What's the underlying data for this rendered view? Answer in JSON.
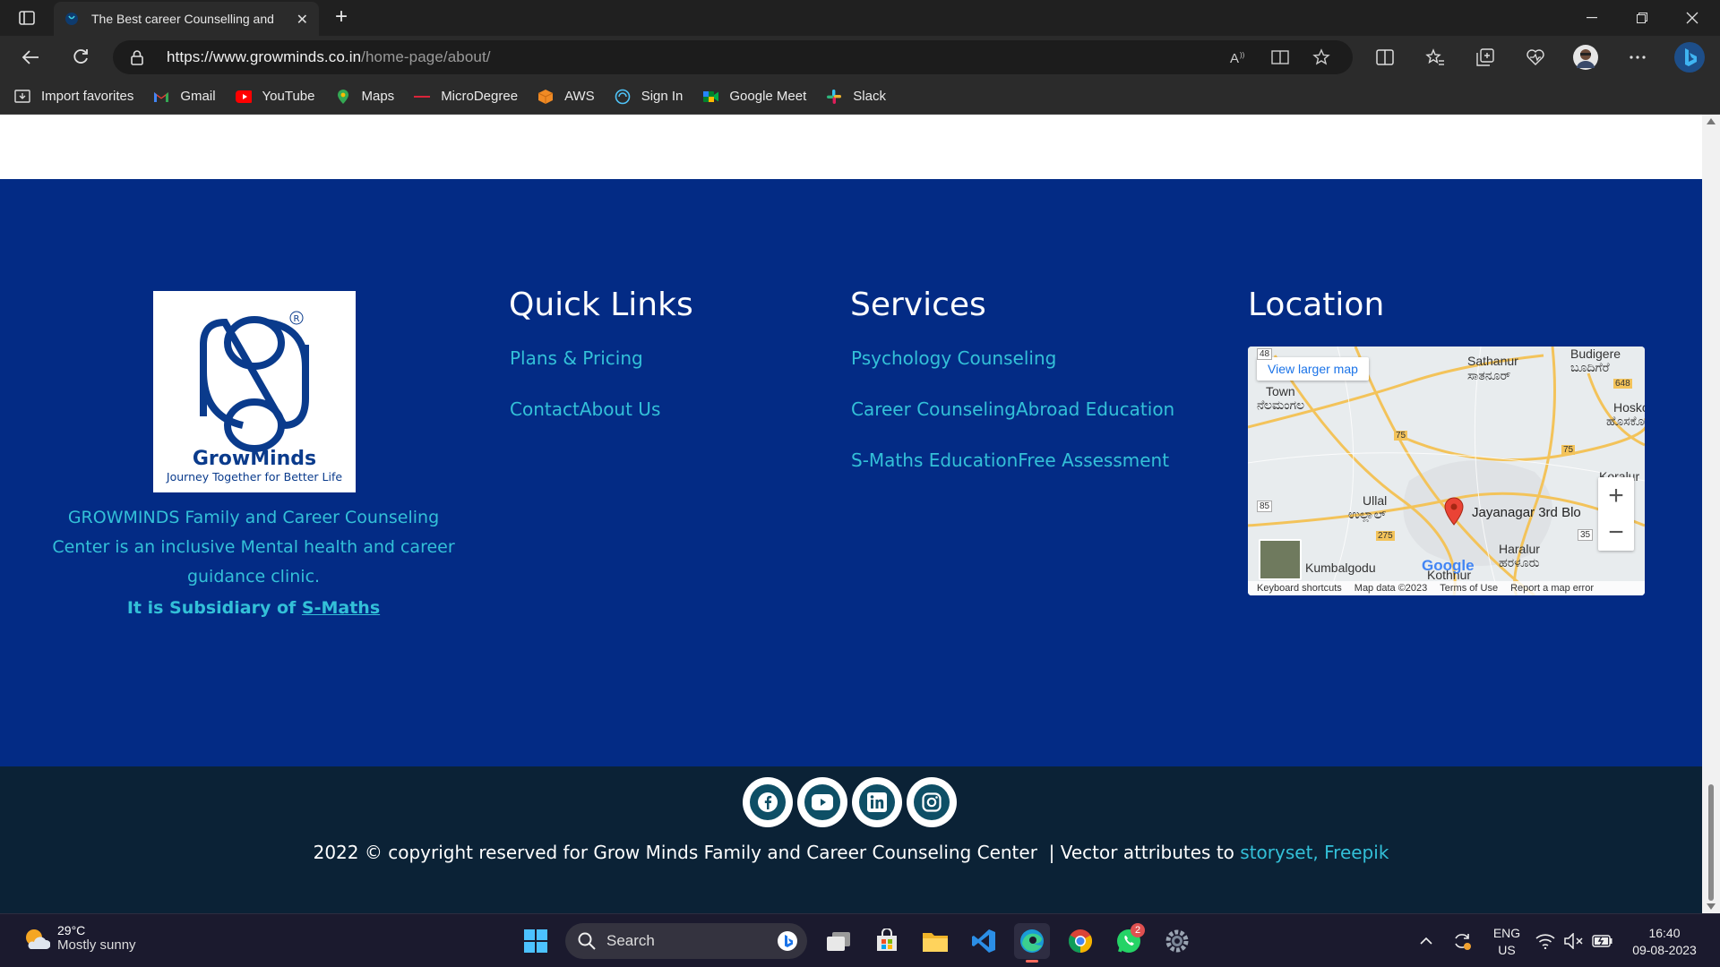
{
  "browser": {
    "tab_title": "The Best career Counselling and",
    "url_host": "https://www.growminds.co.in",
    "url_path": "/home-page/about/"
  },
  "bookmarks": [
    {
      "label": "Import favorites",
      "icon": "import-icon"
    },
    {
      "label": "Gmail",
      "icon": "gmail-icon"
    },
    {
      "label": "YouTube",
      "icon": "youtube-icon"
    },
    {
      "label": "Maps",
      "icon": "maps-icon"
    },
    {
      "label": "MicroDegree",
      "icon": "microdegree-icon"
    },
    {
      "label": "AWS",
      "icon": "aws-icon"
    },
    {
      "label": "Sign In",
      "icon": "signin-icon"
    },
    {
      "label": "Google Meet",
      "icon": "meet-icon"
    },
    {
      "label": "Slack",
      "icon": "slack-icon"
    }
  ],
  "footer": {
    "logo_name": "GrowMinds",
    "logo_tagline": "Journey Together for Better Life",
    "logo_mark": "R",
    "about": "GROWMINDS Family and Career Counseling Center is an inclusive Mental health and career guidance clinic.",
    "subsidiary_prefix": "It is Subsidiary of ",
    "subsidiary_link": "S-Maths",
    "quick_links": {
      "title": "Quick Links",
      "items": [
        "Plans & Pricing",
        "ContactAbout Us"
      ]
    },
    "services": {
      "title": "Services",
      "items": [
        "Psychology Counseling",
        "Career CounselingAbroad Education",
        "S-Maths EducationFree Assessment"
      ]
    },
    "location": {
      "title": "Location",
      "map": {
        "view_larger": "View larger map",
        "pin_label": "Jayanagar 3rd Blo",
        "labels": [
          "Sathanur",
          "ಸಾತನೂರ್",
          "Budigere",
          "ಬೂದಿಗೆರೆ",
          "Town",
          "ನೆಲಮಂಗಲ",
          "Ullal",
          "ಉಲ್ಲಾಲ್",
          "Haralur",
          "ಹರಳೂರು",
          "Kumbalgodu",
          "Kothnur",
          "Hosko",
          "ಹೊಸಕೋ",
          "Koralur"
        ],
        "roads": [
          "48",
          "648",
          "75",
          "75",
          "85",
          "275",
          "35"
        ],
        "zoom_in": "+",
        "zoom_out": "−",
        "attribution": [
          "Keyboard shortcuts",
          "Map data ©2023",
          "Terms of Use",
          "Report a map error"
        ],
        "google": "Google"
      }
    },
    "social": [
      "facebook-icon",
      "youtube-icon",
      "linkedin-icon",
      "instagram-icon"
    ],
    "copyright": "2022 © copyright reserved for Grow Minds Family and Career Counseling Center  | Vector attributes to ",
    "attributes_link": "storyset, Freepik"
  },
  "taskbar": {
    "weather_temp": "29°C",
    "weather_desc": "Mostly sunny",
    "search_placeholder": "Search",
    "lang_top": "ENG",
    "lang_bottom": "US",
    "time": "16:40",
    "date": "09-08-2023",
    "whatsapp_badge": "2"
  },
  "colors": {
    "footer_blue": "#032b85",
    "footer_dark": "#0b2236",
    "link_cyan": "#33c0d8",
    "logo_navy": "#0a3b8c"
  }
}
